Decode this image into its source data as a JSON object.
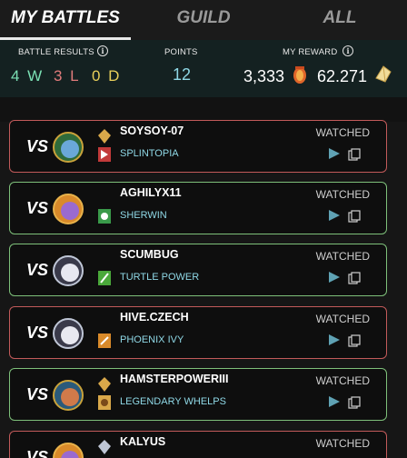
{
  "tabs": [
    {
      "label": "MY BATTLES",
      "active": true
    },
    {
      "label": "GUILD",
      "active": false
    },
    {
      "label": "ALL",
      "active": false
    }
  ],
  "stats": {
    "battle_results_label": "BATTLE RESULTS",
    "wins": "4 W",
    "losses": "3 L",
    "draws": "0 D",
    "points_label": "POINTS",
    "points_value": "12",
    "reward_label": "MY REWARD",
    "reward_merits": "3,333",
    "reward_sps": "62.271"
  },
  "colors": {
    "win": "#7ec07a",
    "loss": "#c25a5a",
    "wins_text": "#7be0b4",
    "losses_text": "#e07b7b",
    "draws_text": "#e8cf5a",
    "accent_cyan": "#8fd8e6"
  },
  "battles": [
    {
      "result": "loss",
      "vs": "VS",
      "player": "SOYSOY-07",
      "guild": "SPLINTOPIA",
      "status": "WATCHED"
    },
    {
      "result": "win",
      "vs": "VS",
      "player": "AGHILYX11",
      "guild": "SHERWIN",
      "status": "WATCHED"
    },
    {
      "result": "win",
      "vs": "VS",
      "player": "SCUMBUG",
      "guild": "TURTLE POWER",
      "status": "WATCHED"
    },
    {
      "result": "loss",
      "vs": "VS",
      "player": "HIVE.CZECH",
      "guild": "PHOENIX IVY",
      "status": "WATCHED"
    },
    {
      "result": "win",
      "vs": "VS",
      "player": "HAMSTERPOWERIII",
      "guild": "LEGENDARY WHELPS",
      "status": "WATCHED"
    },
    {
      "result": "loss",
      "vs": "VS",
      "player": "KALYUS",
      "guild": "",
      "status": "WATCHED"
    }
  ]
}
